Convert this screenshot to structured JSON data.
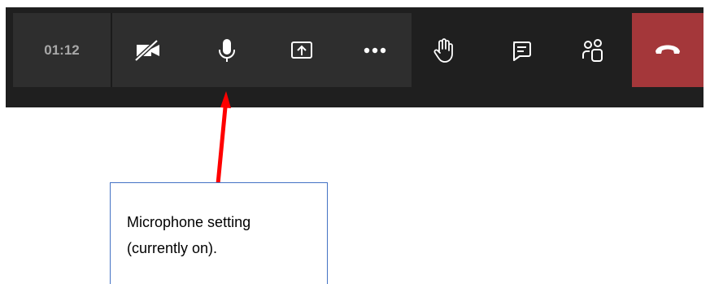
{
  "toolbar": {
    "timer": "01:12",
    "buttons": [
      {
        "name": "camera-off"
      },
      {
        "name": "microphone"
      },
      {
        "name": "share-screen"
      },
      {
        "name": "more-options"
      },
      {
        "name": "raise-hand"
      },
      {
        "name": "chat"
      },
      {
        "name": "participants"
      },
      {
        "name": "hang-up"
      }
    ],
    "colors": {
      "bar": "#1f1f1f",
      "group": "#2e2e2e",
      "hangup": "#a4373a",
      "icon": "#ffffff",
      "timer_text": "#a8a8a8"
    }
  },
  "annotation": {
    "line1": "Microphone setting",
    "line2": "(currently on).",
    "arrow_color": "#ff0000",
    "box_border_color": "#4472c4"
  }
}
